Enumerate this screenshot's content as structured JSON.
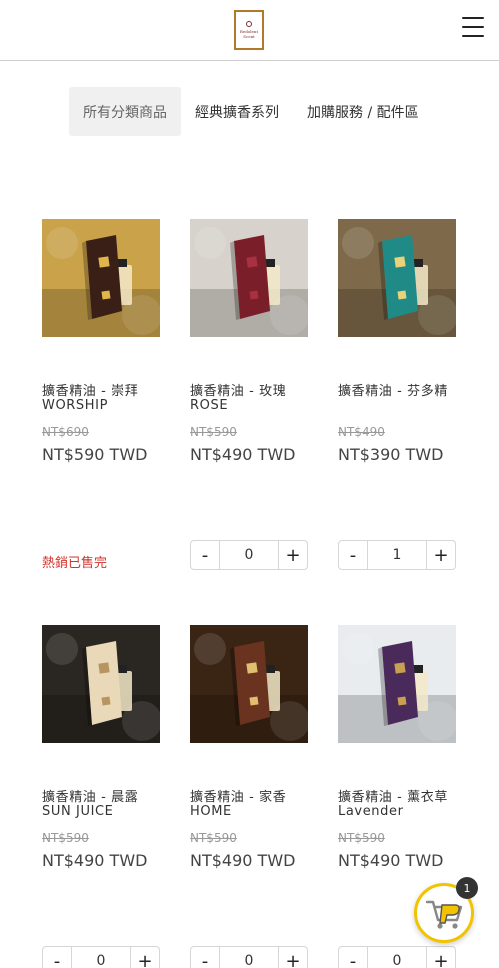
{
  "header": {
    "logo_text": "Redolent\nScent",
    "menu_icon": "hamburger-menu-icon"
  },
  "tabs": [
    {
      "label": "所有分類商品",
      "active": true
    },
    {
      "label": "經典擴香系列",
      "active": false
    },
    {
      "label": "加購服務 / 配件區",
      "active": false
    }
  ],
  "products": [
    {
      "name": "擴香精油 - 崇拜 WORSHIP",
      "old_price": "NT$690",
      "price": "NT$590 TWD",
      "status": "熱銷已售完",
      "image": "worship-product-photo",
      "palette": {
        "bg": "#c9a24a",
        "box": "#3a1f16",
        "accent": "#e0b64a"
      }
    },
    {
      "name": "擴香精油 - 玫瑰 ROSE",
      "old_price": "NT$590",
      "price": "NT$490 TWD",
      "quantity": "0",
      "image": "rose-product-photo",
      "palette": {
        "bg": "#d7d2cb",
        "box": "#7a1f2a",
        "accent": "#a83040"
      }
    },
    {
      "name": "擴香精油 - 芬多精",
      "old_price": "NT$490",
      "price": "NT$390 TWD",
      "quantity": "1",
      "image": "phytoncide-product-photo",
      "palette": {
        "bg": "#7e6a4a",
        "box": "#1f8a86",
        "accent": "#e9d27a"
      }
    },
    {
      "name": "擴香精油 - 晨露 SUN JUICE",
      "old_price": "NT$590",
      "price": "NT$490 TWD",
      "quantity": "0",
      "image": "sun-juice-product-photo",
      "palette": {
        "bg": "#2a2622",
        "box": "#e9d9b8",
        "accent": "#b89560"
      }
    },
    {
      "name": "擴香精油 - 家香 HOME",
      "old_price": "NT$590",
      "price": "NT$490 TWD",
      "quantity": "0",
      "image": "home-product-photo",
      "palette": {
        "bg": "#3a2414",
        "box": "#6a3320",
        "accent": "#e0c070"
      }
    },
    {
      "name": "擴香精油 - 薰衣草 Lavender",
      "old_price": "NT$590",
      "price": "NT$490 TWD",
      "quantity": "0",
      "image": "lavender-product-photo",
      "palette": {
        "bg": "#e8ecef",
        "box": "#4a2a5a",
        "accent": "#c8a050"
      }
    }
  ],
  "stepper": {
    "minus_label": "-",
    "plus_label": "+"
  },
  "cart": {
    "badge_count": "1",
    "icon": "shopping-cart-icon",
    "accent": "#f2c300"
  }
}
